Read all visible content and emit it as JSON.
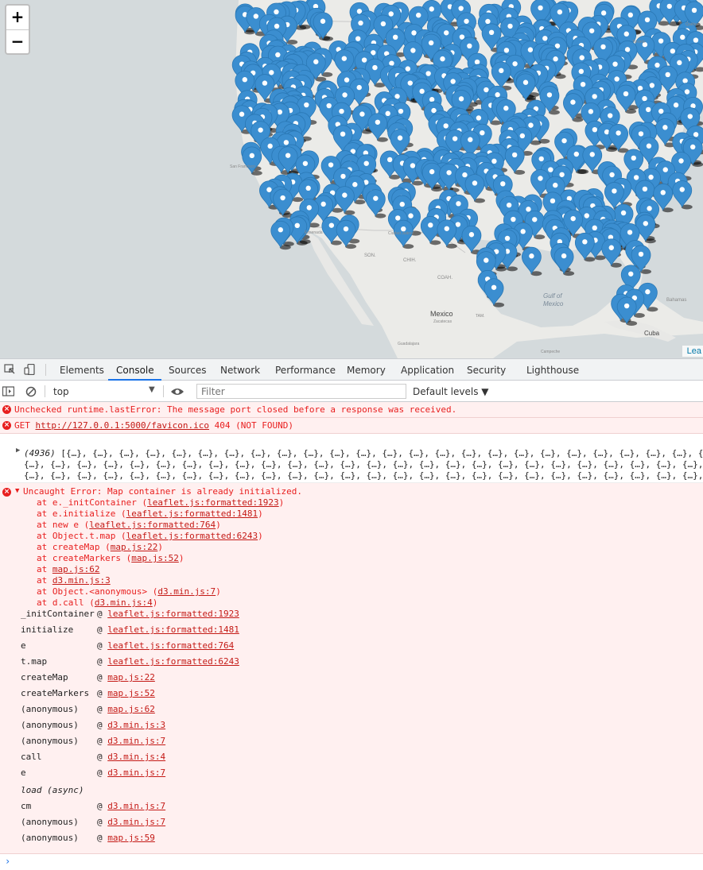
{
  "map": {
    "zoom_in": "+",
    "zoom_out": "−",
    "attribution": "Lea",
    "labels": {
      "mexico": "Mexico",
      "gulf": "Gulf of Mexico",
      "cuba": "Cuba",
      "bahamas": "Bahamas",
      "son": "SON.",
      "coah": "COAH.",
      "chih": "CHIH.",
      "zacatecas": "Zacatecas",
      "san_francisco": "San Francisco",
      "ensenada": "Ensenada",
      "ciudad_juarez": "Ciudad Juárez",
      "tamaulipas": "TAM.",
      "toronto": "Toronto",
      "quebec": "Québec",
      "campeche": "Campeche",
      "guadalajara": "Guadalajara"
    },
    "marker_color": "#3b8ed0"
  },
  "devtools": {
    "tabs": [
      "Elements",
      "Console",
      "Sources",
      "Network",
      "Performance",
      "Memory",
      "Application",
      "Security",
      "Lighthouse"
    ],
    "active_tab": "Console",
    "context": "top",
    "filter_placeholder": "Filter",
    "levels": "Default levels ▼"
  },
  "console": {
    "msg1": "Unchecked runtime.lastError: The message port closed before a response was received.",
    "msg2_prefix": "GET ",
    "msg2_url": "http://127.0.0.1:5000/favicon.ico",
    "msg2_suffix": " 404 (NOT FOUND)",
    "array_count": "(4936)",
    "array_line1": "[{…}, {…}, {…}, {…}, {…}, {…}, {…}, {…}, {…}, {…}, {…}, {…}, {…}, {…}, {…}, {…}, {…}, {…}, {…}, {…}, {…}, {…}, {…}, {…}, {…}, {…}, {…}, {…}, {…}, {…}, {…}, {…}, {…}, {…}, {…}, {…}, {…}, {…}, {…}, {…}, {…}, {…}, {…}, {…}, {…}, {…}, {…}, {…},",
    "array_line2": "{…}, {…}, {…}, {…}, {…}, {…}, {…}, {…}, {…}, {…}, {…}, {…}, {…}, {…}, {…}, {…}, {…}, {…}, {…}, {…}, {…}, {…}, {…}, {…}, {…}, {…}, {…}, {…}, {…}, {…}, {…}, {…}, {…}, {…}, {…}, {…}, {…}, {…}, {…}, {…}, {…}, {…}, {…}, {…}, {…}, {…}, {…}, {…},",
    "array_line3": "{…}, {…}, {…}, {…}, {…}, {…}, {…}, {…}, {…}, {…}, {…}, {…}, {…}, {…}, {…}, {…}, {…}, {…}, {…}, {…}, {…}, {…}, {…}, {…}, {…}, {…}, {…}, {…}, {…}, {…}, {…}, {…}, {…}, {…}, {…}, {…}, {…}, {…}, {…}, {…}, {…}, {…}, {…}, {…}, {…}, {…}, {…}, {…},",
    "error_title": "Uncaught Error: Map container is already initialized.",
    "error_trace": [
      {
        "pre": "at e._initContainer (",
        "link": "leaflet.js:formatted:1923",
        "post": ")"
      },
      {
        "pre": "at e.initialize (",
        "link": "leaflet.js:formatted:1481",
        "post": ")"
      },
      {
        "pre": "at new e (",
        "link": "leaflet.js:formatted:764",
        "post": ")"
      },
      {
        "pre": "at Object.t.map (",
        "link": "leaflet.js:formatted:6243",
        "post": ")"
      },
      {
        "pre": "at createMap (",
        "link": "map.js:22",
        "post": ")"
      },
      {
        "pre": "at createMarkers (",
        "link": "map.js:52",
        "post": ")"
      },
      {
        "pre": "at ",
        "link": "map.js:62",
        "post": ""
      },
      {
        "pre": "at ",
        "link": "d3.min.js:3",
        "post": ""
      },
      {
        "pre": "at Object.<anonymous> (",
        "link": "d3.min.js:7",
        "post": ")"
      },
      {
        "pre": "at d.call (",
        "link": "d3.min.js:4",
        "post": ")"
      }
    ],
    "stack": [
      {
        "fn": "_initContainer",
        "link": "leaflet.js:formatted:1923"
      },
      {
        "fn": "initialize",
        "link": "leaflet.js:formatted:1481"
      },
      {
        "fn": "e",
        "link": "leaflet.js:formatted:764"
      },
      {
        "fn": "t.map",
        "link": "leaflet.js:formatted:6243"
      },
      {
        "fn": "createMap",
        "link": "map.js:22"
      },
      {
        "fn": "createMarkers",
        "link": "map.js:52"
      },
      {
        "fn": "(anonymous)",
        "link": "map.js:62"
      },
      {
        "fn": "(anonymous)",
        "link": "d3.min.js:3"
      },
      {
        "fn": "(anonymous)",
        "link": "d3.min.js:7"
      },
      {
        "fn": "call",
        "link": "d3.min.js:4"
      },
      {
        "fn": "e",
        "link": "d3.min.js:7"
      }
    ],
    "async_label": "load (async)",
    "stack2": [
      {
        "fn": "cm",
        "link": "d3.min.js:7"
      },
      {
        "fn": "(anonymous)",
        "link": "d3.min.js:7"
      },
      {
        "fn": "(anonymous)",
        "link": "map.js:59"
      }
    ],
    "at_sign": "@",
    "prompt": "›"
  }
}
